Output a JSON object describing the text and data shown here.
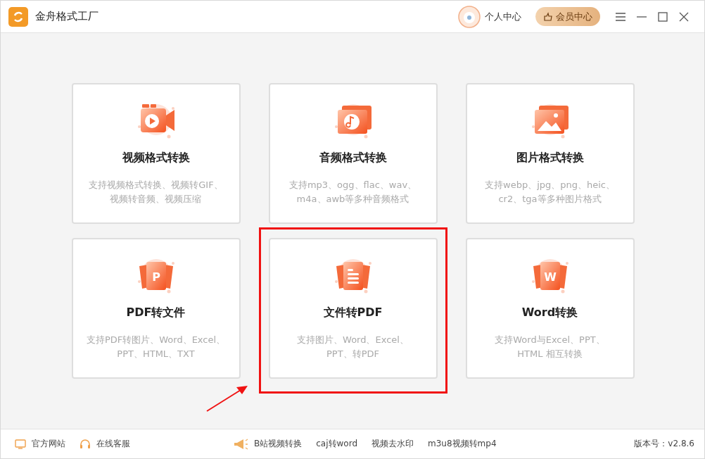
{
  "window": {
    "title": "金舟格式工厂"
  },
  "header": {
    "user_label": "个人中心",
    "vip_button": "会员中心"
  },
  "cards": [
    {
      "kind": "video",
      "title": "视频格式转换",
      "lines": [
        "支持视频格式转换、视频转GIF、",
        "视频转音频、视频压缩"
      ],
      "highlighted": false
    },
    {
      "kind": "audio",
      "title": "音频格式转换",
      "lines": [
        "支持mp3、ogg、flac、wav、",
        "m4a、awb等多种音频格式"
      ],
      "highlighted": false
    },
    {
      "kind": "image",
      "title": "图片格式转换",
      "lines": [
        "支持webp、jpg、png、heic、",
        "cr2、tga等多种图片格式"
      ],
      "highlighted": false
    },
    {
      "kind": "letter",
      "icon_letter": "P",
      "title": "PDF转文件",
      "lines": [
        "支持PDF转图片、Word、Excel、",
        "PPT、HTML、TXT"
      ],
      "highlighted": false
    },
    {
      "kind": "doc",
      "title": "文件转PDF",
      "lines": [
        "支持图片、Word、Excel、",
        "PPT、转PDF"
      ],
      "highlighted": true
    },
    {
      "kind": "letter",
      "icon_letter": "W",
      "title": "Word转换",
      "lines": [
        "支持Word与Excel、PPT、",
        "HTML 相互转换"
      ],
      "highlighted": false
    }
  ],
  "pointer_arrow": true,
  "footer": {
    "left": [
      {
        "kind": "monitor",
        "label": "官方网站"
      },
      {
        "kind": "headset",
        "label": "在线客服"
      }
    ],
    "links": [
      "B站视频转换",
      "caj转word",
      "视频去水印",
      "m3u8视频转mp4"
    ],
    "version": "版本号：v2.8.6"
  }
}
